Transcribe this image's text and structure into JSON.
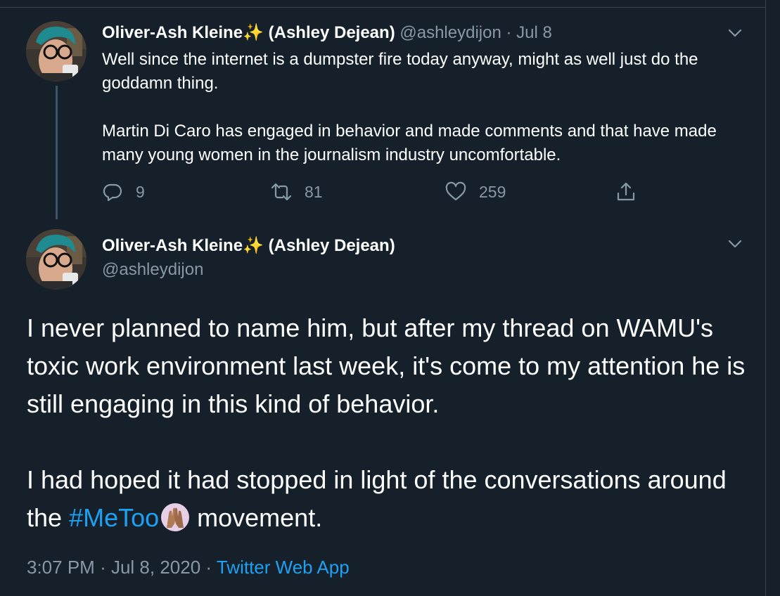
{
  "tweet1": {
    "display_name": "Oliver-Ash Kleine",
    "display_name_suffix": "(Ashley Dejean)",
    "name_emoji": "✨",
    "handle": "@ashleydijon",
    "separator": "·",
    "date": "Jul 8",
    "paragraphs": [
      "Well since the internet is a dumpster fire today anyway, might as well just do the goddamn thing.",
      "Martin Di Caro has engaged in behavior and made comments and that have made many young women in the journalism industry uncomfortable."
    ],
    "actions": {
      "replies": "9",
      "retweets": "81",
      "likes": "259"
    },
    "icons": [
      "reply-icon",
      "retweet-icon",
      "like-icon",
      "share-icon",
      "chevron-down-icon"
    ]
  },
  "tweet2": {
    "display_name": "Oliver-Ash Kleine",
    "display_name_suffix": "(Ashley Dejean)",
    "name_emoji": "✨",
    "handle": "@ashleydijon",
    "paragraph1": "I never planned to name him, but after my thread on WAMU's toxic work environment last week, it's come to my attention he is still engaging in this kind of behavior.",
    "paragraph2_before": "I had hoped it had stopped in light of the conversations around the",
    "hashtag": "#MeToo",
    "paragraph2_after": "movement.",
    "time": "3:07 PM",
    "separator": "·",
    "date": "Jul 8, 2020",
    "separator2": "·",
    "source": "Twitter Web App"
  },
  "colors": {
    "background": "#15202b",
    "text": "#ffffff",
    "secondary": "#8899a6",
    "link": "#1da1f2",
    "border": "#38444d"
  }
}
